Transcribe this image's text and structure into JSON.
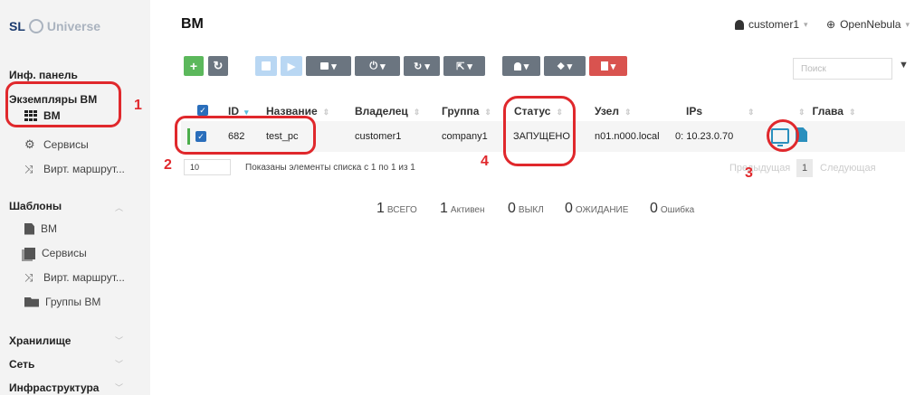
{
  "sidebar": {
    "logo_sl": "SL",
    "logo_universe": "Universe",
    "dashboard": "Инф. панель",
    "vm_instances": "Экземпляры ВМ",
    "vm_instances_items": [
      "ВМ",
      "Сервисы",
      "Вирт. маршрут..."
    ],
    "templates": "Шаблоны",
    "templates_items": [
      "ВМ",
      "Сервисы",
      "Вирт. маршрут...",
      "Группы ВМ"
    ],
    "storage": "Хранилище",
    "network": "Сеть",
    "infrastructure": "Инфраструктура"
  },
  "header": {
    "title": "ВМ",
    "user": "customer1",
    "zone": "OpenNebula"
  },
  "toolbar": {
    "add": "+",
    "refresh": "↻",
    "search_placeholder": "Поиск"
  },
  "table": {
    "columns": [
      "ID",
      "Название",
      "Владелец",
      "Группа",
      "Статус",
      "Узел",
      "IPs",
      "Глава"
    ],
    "rows": [
      {
        "id": "682",
        "name": "test_pc",
        "owner": "customer1",
        "group": "company1",
        "status": "ЗАПУЩЕНО",
        "host": "n01.n000.local",
        "ips": "0: 10.23.0.70"
      }
    ]
  },
  "pagination": {
    "per_page": "10",
    "showing": "Показаны элементы списка с 1 по 1 из 1",
    "prev": "Предыдущая",
    "page": "1",
    "next": "Следующая"
  },
  "stats": [
    {
      "num": "1",
      "label": "ВСЕГО"
    },
    {
      "num": "1",
      "label": "Активен"
    },
    {
      "num": "0",
      "label": "ВЫКЛ"
    },
    {
      "num": "0",
      "label": "ОЖИДАНИЕ"
    },
    {
      "num": "0",
      "label": "Ошибка"
    }
  ],
  "annotations": [
    "1",
    "2",
    "3",
    "4"
  ],
  "colors": {
    "highlight": "#e0282c",
    "accent": "#2a6ebb",
    "success": "#5cb85c"
  }
}
